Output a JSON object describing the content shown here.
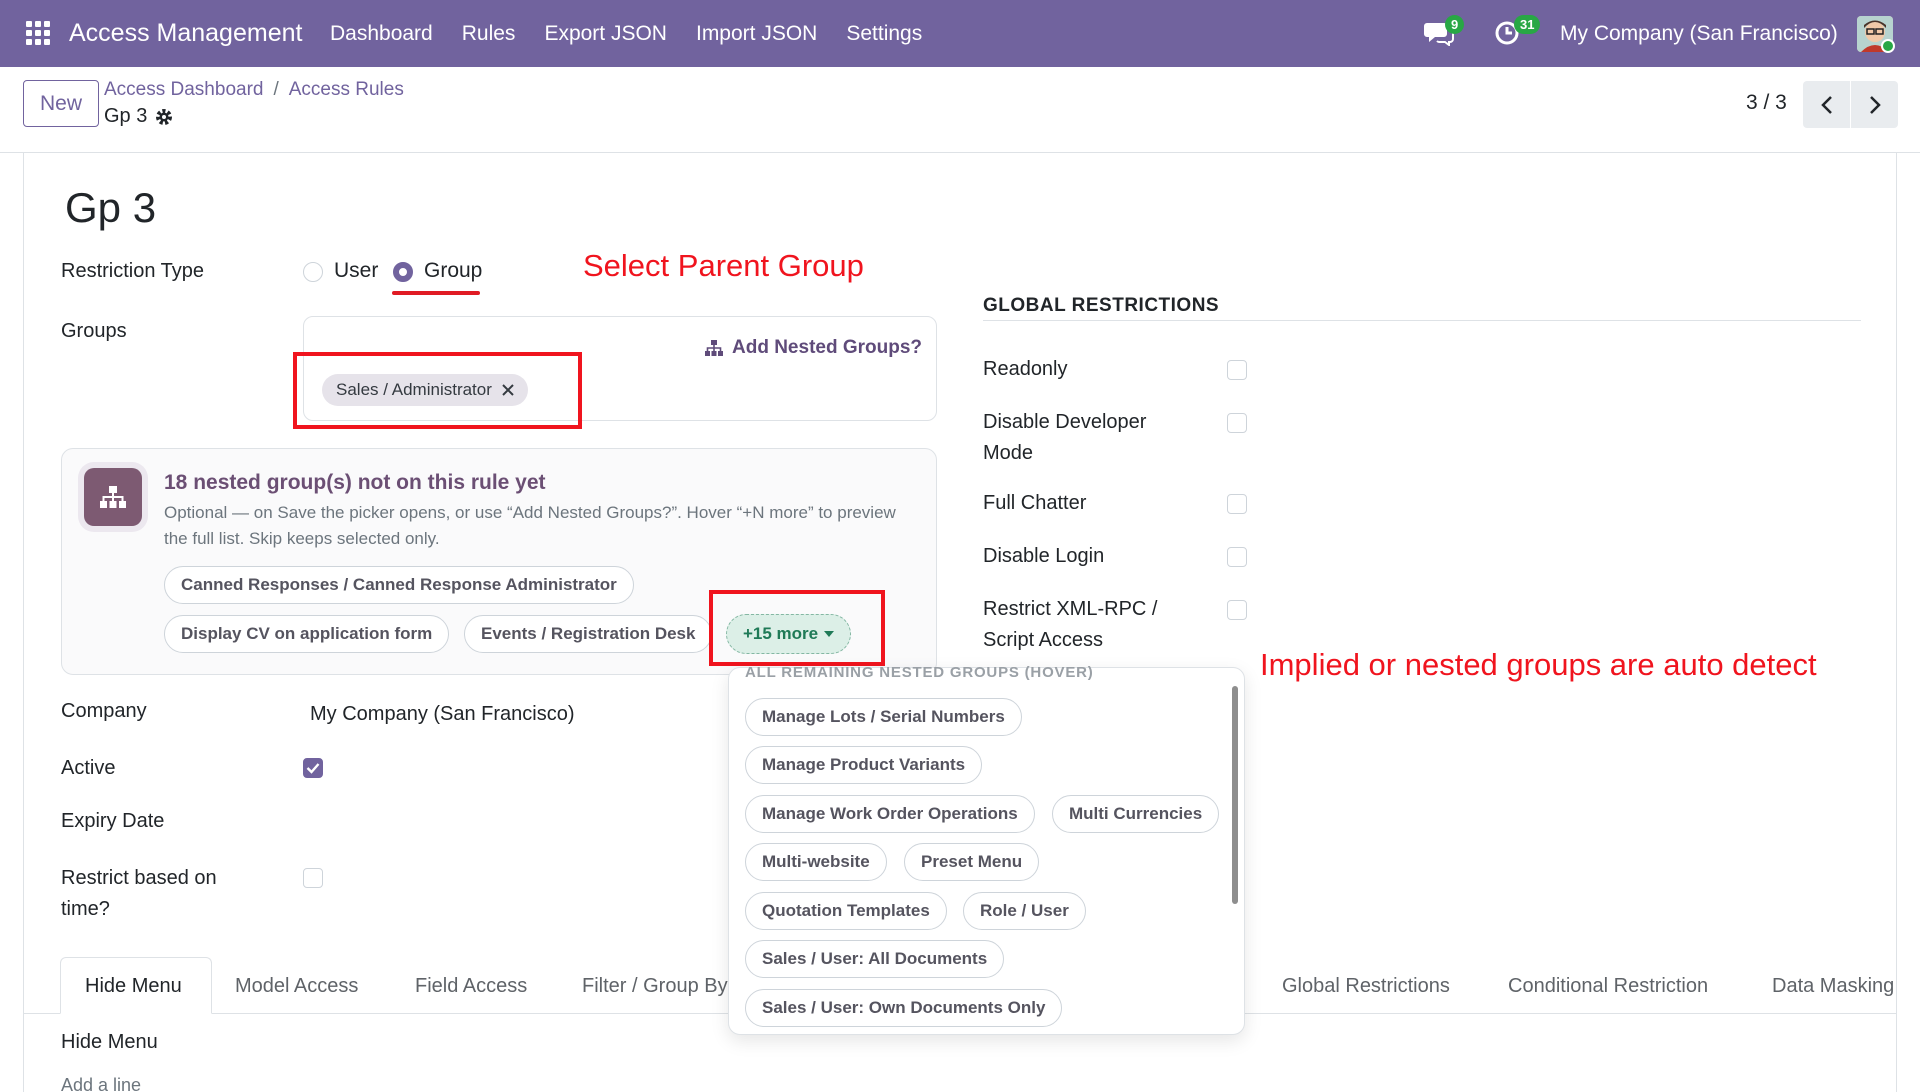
{
  "navbar": {
    "app_title": "Access Management",
    "menu": [
      "Dashboard",
      "Rules",
      "Export JSON",
      "Import JSON",
      "Settings"
    ],
    "chat_badge": "9",
    "activity_badge": "31",
    "company": "My Company (San Francisco)",
    "brand_color": "#71639e"
  },
  "control_panel": {
    "new_label": "New",
    "breadcrumb": [
      "Access Dashboard",
      "Access Rules"
    ],
    "breadcrumb_sep": "/",
    "record_name": "Gp 3",
    "pager": "3 / 3"
  },
  "form": {
    "title": "Gp 3",
    "restriction_type_label": "Restriction Type",
    "restriction_options": [
      "User",
      "Group"
    ],
    "restriction_selected": "Group",
    "groups_label": "Groups",
    "add_nested_label": "Add Nested Groups?",
    "selected_group_tag": "Sales / Administrator",
    "nested": {
      "heading": "18 nested group(s) not on this rule yet",
      "description": "Optional — on Save the picker opens, or use “Add Nested Groups?”. Hover “+N more” to preview the full list. Skip keeps selected only.",
      "pills": [
        "Canned Responses / Canned Response Administrator",
        "Display CV on application form",
        "Events / Registration Desk"
      ],
      "more_label": "+15 more"
    },
    "popover": {
      "header": "ALL REMAINING NESTED GROUPS (HOVER)",
      "items": [
        "Manage Lots / Serial Numbers",
        "Manage Product Variants",
        "Manage Work Order Operations",
        "Multi Currencies",
        "Multi-website",
        "Preset Menu",
        "Quotation Templates",
        "Role / User",
        "Sales / User: All Documents",
        "Sales / User: Own Documents Only"
      ]
    },
    "company_label": "Company",
    "company_value": "My Company (San Francisco)",
    "active_label": "Active",
    "active_checked": true,
    "expiry_label": "Expiry Date",
    "time_label_line1": "Restrict based on",
    "time_label_line2": "time?",
    "global_restrictions": {
      "heading": "GLOBAL RESTRICTIONS",
      "readonly": "Readonly",
      "disable_dev_line1": "Disable Developer",
      "disable_dev_line2": "Mode",
      "full_chatter": "Full Chatter",
      "disable_login": "Disable Login",
      "xmlrpc_line1": "Restrict XML-RPC /",
      "xmlrpc_line2": "Script Access"
    }
  },
  "annotations": {
    "select_parent": "Select Parent Group",
    "auto_detect": "Implied or nested groups are auto detect",
    "color": "#f0141e"
  },
  "tabs": {
    "items": [
      "Hide Menu",
      "Model Access",
      "Field Access",
      "Filter / Group By",
      "Global Restrictions",
      "Conditional Restriction",
      "Data Masking"
    ],
    "active": "Hide Menu"
  },
  "tab_content": {
    "heading": "Hide Menu",
    "cutoff_text": "Add a line"
  }
}
